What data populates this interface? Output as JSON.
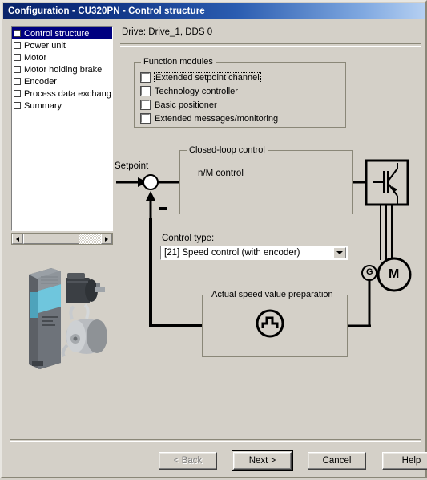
{
  "window": {
    "title": "Configuration - CU320PN - Control structure"
  },
  "sidebar": {
    "items": [
      {
        "label": "Control structure",
        "selected": true
      },
      {
        "label": "Power unit",
        "selected": false
      },
      {
        "label": "Motor",
        "selected": false
      },
      {
        "label": "Motor holding brake",
        "selected": false
      },
      {
        "label": "Encoder",
        "selected": false
      },
      {
        "label": "Process data exchang",
        "selected": false
      },
      {
        "label": "Summary",
        "selected": false
      }
    ],
    "scrollbar": {
      "left_arrow": "left-arrow-icon",
      "right_arrow": "right-arrow-icon"
    }
  },
  "header": {
    "drive_label": "Drive: Drive_1, DDS 0"
  },
  "function_modules": {
    "title": "Function modules",
    "options": [
      {
        "label": "Extended setpoint channel",
        "checked": false,
        "focused": true
      },
      {
        "label": "Technology controller",
        "checked": false,
        "focused": false
      },
      {
        "label": "Basic positioner",
        "checked": false,
        "focused": false
      },
      {
        "label": "Extended messages/monitoring",
        "checked": false,
        "focused": false
      }
    ]
  },
  "diagram": {
    "setpoint_label": "Setpoint",
    "minus_sign": "-",
    "closed_loop": {
      "title": "Closed-loop control",
      "content": "n/M control"
    },
    "speed_preparation": {
      "title": "Actual speed value preparation",
      "icon": "pulse-encoder-icon"
    },
    "inverter_icon": "igbt-inverter-icon",
    "motor_label": "M",
    "encoder_label": "G"
  },
  "control_type": {
    "label": "Control type:",
    "value": "[21] Speed control (with encoder)",
    "dropdown_icon": "chevron-down-icon"
  },
  "buttons": {
    "back": "< Back",
    "next": "Next >",
    "cancel": "Cancel",
    "help": "Help"
  },
  "colors": {
    "dialog_bg": "#d4d0c8",
    "titlebar_start": "#0a246a",
    "titlebar_end": "#b6d0f2",
    "selection": "#000080"
  }
}
